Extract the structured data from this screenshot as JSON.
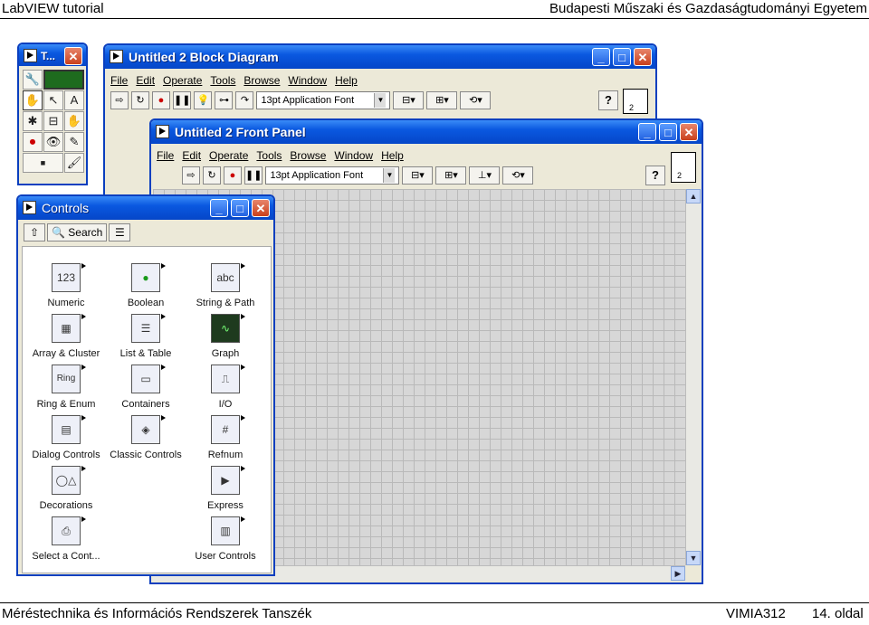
{
  "slide": {
    "header_left": "LabVIEW tutorial",
    "header_right": "Budapesti Műszaki és Gazdaságtudományi Egyetem",
    "footer_left": "Méréstechnika és Információs Rendszerek Tanszék",
    "course": "VIMIA312",
    "page": "14. oldal"
  },
  "tools_palette": {
    "title": "T...",
    "tools": [
      "🔧",
      "▬",
      "✋",
      "↖",
      "A",
      "✱",
      "⊟",
      "✋",
      "⏺",
      "👁",
      "✎",
      "▪",
      "🖌"
    ]
  },
  "controls_palette": {
    "title": "Controls",
    "toolbar": {
      "up": "⇧",
      "search": "Search",
      "view": "☰"
    },
    "items": [
      {
        "label": "Numeric",
        "glyph": "123"
      },
      {
        "label": "Boolean",
        "glyph": "●"
      },
      {
        "label": "String & Path",
        "glyph": "abc"
      },
      {
        "label": "Array & Cluster",
        "glyph": "▦"
      },
      {
        "label": "List & Table",
        "glyph": "☰"
      },
      {
        "label": "Graph",
        "glyph": "∿"
      },
      {
        "label": "Ring & Enum",
        "glyph": "Ring"
      },
      {
        "label": "Containers",
        "glyph": "▭"
      },
      {
        "label": "I/O",
        "glyph": "⎍"
      },
      {
        "label": "Dialog Controls",
        "glyph": "▤"
      },
      {
        "label": "Classic Controls",
        "glyph": "◈"
      },
      {
        "label": "Refnum",
        "glyph": "#"
      },
      {
        "label": "Decorations",
        "glyph": "◯△"
      },
      {
        "label": "Express",
        "glyph": "▶"
      },
      {
        "label": "Select a Cont...",
        "glyph": "⎙"
      },
      {
        "label": "User Controls",
        "glyph": "▥"
      }
    ]
  },
  "block_diagram": {
    "title": "Untitled 2 Block Diagram",
    "menu": [
      "File",
      "Edit",
      "Operate",
      "Tools",
      "Browse",
      "Window",
      "Help"
    ],
    "font": "13pt Application Font",
    "vi_icon_num": "2"
  },
  "front_panel": {
    "title": "Untitled 2 Front Panel",
    "menu": [
      "File",
      "Edit",
      "Operate",
      "Tools",
      "Browse",
      "Window",
      "Help"
    ],
    "font": "13pt Application Font",
    "vi_icon_num": "2",
    "help": "?"
  },
  "window_buttons": {
    "min": "_",
    "max": "□",
    "close": "✕"
  }
}
